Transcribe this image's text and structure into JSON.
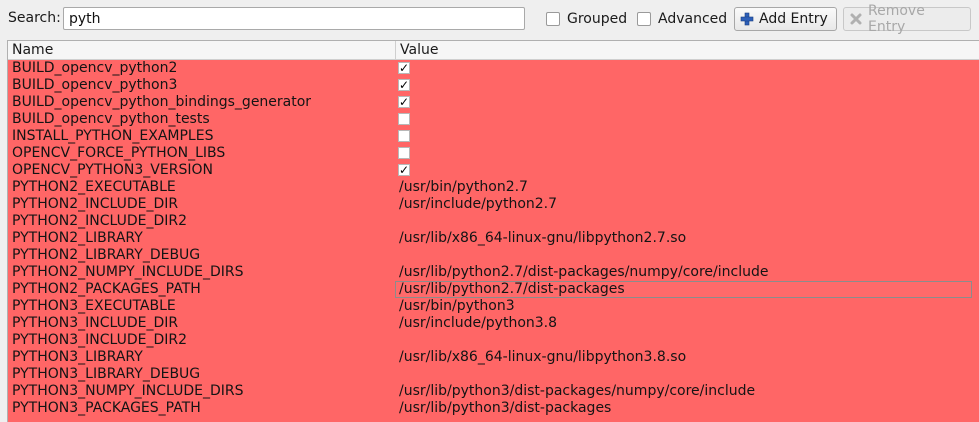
{
  "search": {
    "label": "Search:",
    "value": "pyth"
  },
  "options": {
    "grouped_label": "Grouped",
    "advanced_label": "Advanced"
  },
  "buttons": {
    "add_entry": "Add Entry",
    "remove_entry": "Remove Entry"
  },
  "table": {
    "headers": [
      "Name",
      "Value"
    ],
    "rows": [
      {
        "name": "BUILD_opencv_python2",
        "type": "bool",
        "checked": true,
        "value": ""
      },
      {
        "name": "BUILD_opencv_python3",
        "type": "bool",
        "checked": true,
        "value": ""
      },
      {
        "name": "BUILD_opencv_python_bindings_generator",
        "type": "bool",
        "checked": true,
        "value": ""
      },
      {
        "name": "BUILD_opencv_python_tests",
        "type": "bool",
        "checked": false,
        "value": ""
      },
      {
        "name": "INSTALL_PYTHON_EXAMPLES",
        "type": "bool",
        "checked": false,
        "value": ""
      },
      {
        "name": "OPENCV_FORCE_PYTHON_LIBS",
        "type": "bool",
        "checked": false,
        "value": ""
      },
      {
        "name": "OPENCV_PYTHON3_VERSION",
        "type": "bool",
        "checked": true,
        "value": ""
      },
      {
        "name": "PYTHON2_EXECUTABLE",
        "type": "text",
        "value": "/usr/bin/python2.7"
      },
      {
        "name": "PYTHON2_INCLUDE_DIR",
        "type": "text",
        "value": "/usr/include/python2.7"
      },
      {
        "name": "PYTHON2_INCLUDE_DIR2",
        "type": "text",
        "value": ""
      },
      {
        "name": "PYTHON2_LIBRARY",
        "type": "text",
        "value": "/usr/lib/x86_64-linux-gnu/libpython2.7.so"
      },
      {
        "name": "PYTHON2_LIBRARY_DEBUG",
        "type": "text",
        "value": ""
      },
      {
        "name": "PYTHON2_NUMPY_INCLUDE_DIRS",
        "type": "text",
        "value": "/usr/lib/python2.7/dist-packages/numpy/core/include"
      },
      {
        "name": "PYTHON2_PACKAGES_PATH",
        "type": "text",
        "value": "/usr/lib/python2.7/dist-packages",
        "selected": true
      },
      {
        "name": "PYTHON3_EXECUTABLE",
        "type": "text",
        "value": "/usr/bin/python3"
      },
      {
        "name": "PYTHON3_INCLUDE_DIR",
        "type": "text",
        "value": "/usr/include/python3.8"
      },
      {
        "name": "PYTHON3_INCLUDE_DIR2",
        "type": "text",
        "value": ""
      },
      {
        "name": "PYTHON3_LIBRARY",
        "type": "text",
        "value": "/usr/lib/x86_64-linux-gnu/libpython3.8.so"
      },
      {
        "name": "PYTHON3_LIBRARY_DEBUG",
        "type": "text",
        "value": ""
      },
      {
        "name": "PYTHON3_NUMPY_INCLUDE_DIRS",
        "type": "text",
        "value": "/usr/lib/python3/dist-packages/numpy/core/include"
      },
      {
        "name": "PYTHON3_PACKAGES_PATH",
        "type": "text",
        "value": "/usr/lib/python3/dist-packages"
      }
    ]
  },
  "colors": {
    "changed_row_bg": "#ff6666",
    "add_icon": "#2d5fb8"
  },
  "icons": {
    "add": "plus-icon",
    "remove": "x-icon"
  }
}
